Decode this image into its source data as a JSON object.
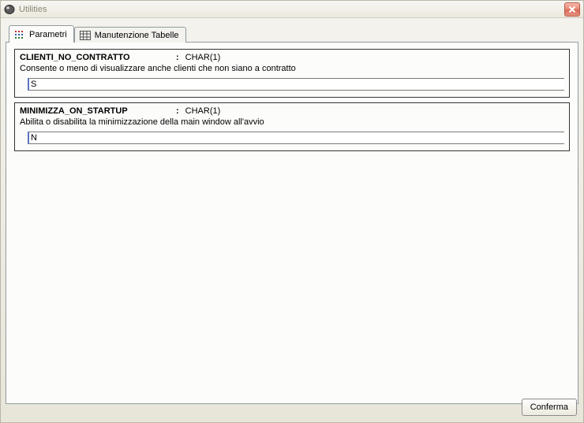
{
  "window": {
    "title": "Utilities"
  },
  "tabs": {
    "parametri": {
      "label": "Parametri"
    },
    "manutenzione": {
      "label": "Manutenzione Tabelle"
    }
  },
  "params": [
    {
      "name": "CLIENTI_NO_CONTRATTO",
      "colon": ":",
      "type": "CHAR(1)",
      "desc": "Consente o meno di visualizzare anche clienti che non siano a contratto",
      "value": "S"
    },
    {
      "name": "MINIMIZZA_ON_STARTUP",
      "colon": ":",
      "type": "CHAR(1)",
      "desc": "Abilita o disabilita la minimizzazione della main window all'avvio",
      "value": "N"
    }
  ],
  "buttons": {
    "confirm": "Conferma"
  }
}
